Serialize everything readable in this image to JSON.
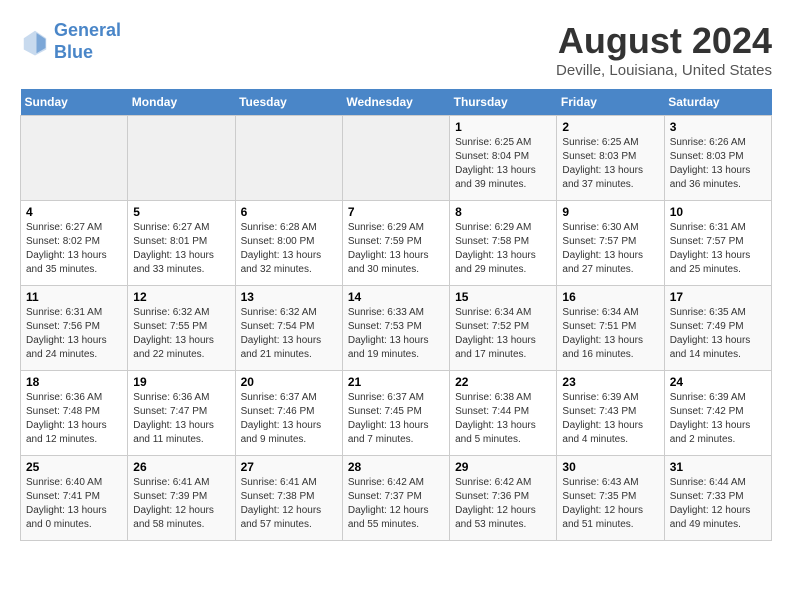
{
  "header": {
    "logo_line1": "General",
    "logo_line2": "Blue",
    "month_year": "August 2024",
    "location": "Deville, Louisiana, United States"
  },
  "days_of_week": [
    "Sunday",
    "Monday",
    "Tuesday",
    "Wednesday",
    "Thursday",
    "Friday",
    "Saturday"
  ],
  "weeks": [
    [
      {
        "day": "",
        "info": ""
      },
      {
        "day": "",
        "info": ""
      },
      {
        "day": "",
        "info": ""
      },
      {
        "day": "",
        "info": ""
      },
      {
        "day": "1",
        "info": "Sunrise: 6:25 AM\nSunset: 8:04 PM\nDaylight: 13 hours\nand 39 minutes."
      },
      {
        "day": "2",
        "info": "Sunrise: 6:25 AM\nSunset: 8:03 PM\nDaylight: 13 hours\nand 37 minutes."
      },
      {
        "day": "3",
        "info": "Sunrise: 6:26 AM\nSunset: 8:03 PM\nDaylight: 13 hours\nand 36 minutes."
      }
    ],
    [
      {
        "day": "4",
        "info": "Sunrise: 6:27 AM\nSunset: 8:02 PM\nDaylight: 13 hours\nand 35 minutes."
      },
      {
        "day": "5",
        "info": "Sunrise: 6:27 AM\nSunset: 8:01 PM\nDaylight: 13 hours\nand 33 minutes."
      },
      {
        "day": "6",
        "info": "Sunrise: 6:28 AM\nSunset: 8:00 PM\nDaylight: 13 hours\nand 32 minutes."
      },
      {
        "day": "7",
        "info": "Sunrise: 6:29 AM\nSunset: 7:59 PM\nDaylight: 13 hours\nand 30 minutes."
      },
      {
        "day": "8",
        "info": "Sunrise: 6:29 AM\nSunset: 7:58 PM\nDaylight: 13 hours\nand 29 minutes."
      },
      {
        "day": "9",
        "info": "Sunrise: 6:30 AM\nSunset: 7:57 PM\nDaylight: 13 hours\nand 27 minutes."
      },
      {
        "day": "10",
        "info": "Sunrise: 6:31 AM\nSunset: 7:57 PM\nDaylight: 13 hours\nand 25 minutes."
      }
    ],
    [
      {
        "day": "11",
        "info": "Sunrise: 6:31 AM\nSunset: 7:56 PM\nDaylight: 13 hours\nand 24 minutes."
      },
      {
        "day": "12",
        "info": "Sunrise: 6:32 AM\nSunset: 7:55 PM\nDaylight: 13 hours\nand 22 minutes."
      },
      {
        "day": "13",
        "info": "Sunrise: 6:32 AM\nSunset: 7:54 PM\nDaylight: 13 hours\nand 21 minutes."
      },
      {
        "day": "14",
        "info": "Sunrise: 6:33 AM\nSunset: 7:53 PM\nDaylight: 13 hours\nand 19 minutes."
      },
      {
        "day": "15",
        "info": "Sunrise: 6:34 AM\nSunset: 7:52 PM\nDaylight: 13 hours\nand 17 minutes."
      },
      {
        "day": "16",
        "info": "Sunrise: 6:34 AM\nSunset: 7:51 PM\nDaylight: 13 hours\nand 16 minutes."
      },
      {
        "day": "17",
        "info": "Sunrise: 6:35 AM\nSunset: 7:49 PM\nDaylight: 13 hours\nand 14 minutes."
      }
    ],
    [
      {
        "day": "18",
        "info": "Sunrise: 6:36 AM\nSunset: 7:48 PM\nDaylight: 13 hours\nand 12 minutes."
      },
      {
        "day": "19",
        "info": "Sunrise: 6:36 AM\nSunset: 7:47 PM\nDaylight: 13 hours\nand 11 minutes."
      },
      {
        "day": "20",
        "info": "Sunrise: 6:37 AM\nSunset: 7:46 PM\nDaylight: 13 hours\nand 9 minutes."
      },
      {
        "day": "21",
        "info": "Sunrise: 6:37 AM\nSunset: 7:45 PM\nDaylight: 13 hours\nand 7 minutes."
      },
      {
        "day": "22",
        "info": "Sunrise: 6:38 AM\nSunset: 7:44 PM\nDaylight: 13 hours\nand 5 minutes."
      },
      {
        "day": "23",
        "info": "Sunrise: 6:39 AM\nSunset: 7:43 PM\nDaylight: 13 hours\nand 4 minutes."
      },
      {
        "day": "24",
        "info": "Sunrise: 6:39 AM\nSunset: 7:42 PM\nDaylight: 13 hours\nand 2 minutes."
      }
    ],
    [
      {
        "day": "25",
        "info": "Sunrise: 6:40 AM\nSunset: 7:41 PM\nDaylight: 13 hours\nand 0 minutes."
      },
      {
        "day": "26",
        "info": "Sunrise: 6:41 AM\nSunset: 7:39 PM\nDaylight: 12 hours\nand 58 minutes."
      },
      {
        "day": "27",
        "info": "Sunrise: 6:41 AM\nSunset: 7:38 PM\nDaylight: 12 hours\nand 57 minutes."
      },
      {
        "day": "28",
        "info": "Sunrise: 6:42 AM\nSunset: 7:37 PM\nDaylight: 12 hours\nand 55 minutes."
      },
      {
        "day": "29",
        "info": "Sunrise: 6:42 AM\nSunset: 7:36 PM\nDaylight: 12 hours\nand 53 minutes."
      },
      {
        "day": "30",
        "info": "Sunrise: 6:43 AM\nSunset: 7:35 PM\nDaylight: 12 hours\nand 51 minutes."
      },
      {
        "day": "31",
        "info": "Sunrise: 6:44 AM\nSunset: 7:33 PM\nDaylight: 12 hours\nand 49 minutes."
      }
    ]
  ]
}
